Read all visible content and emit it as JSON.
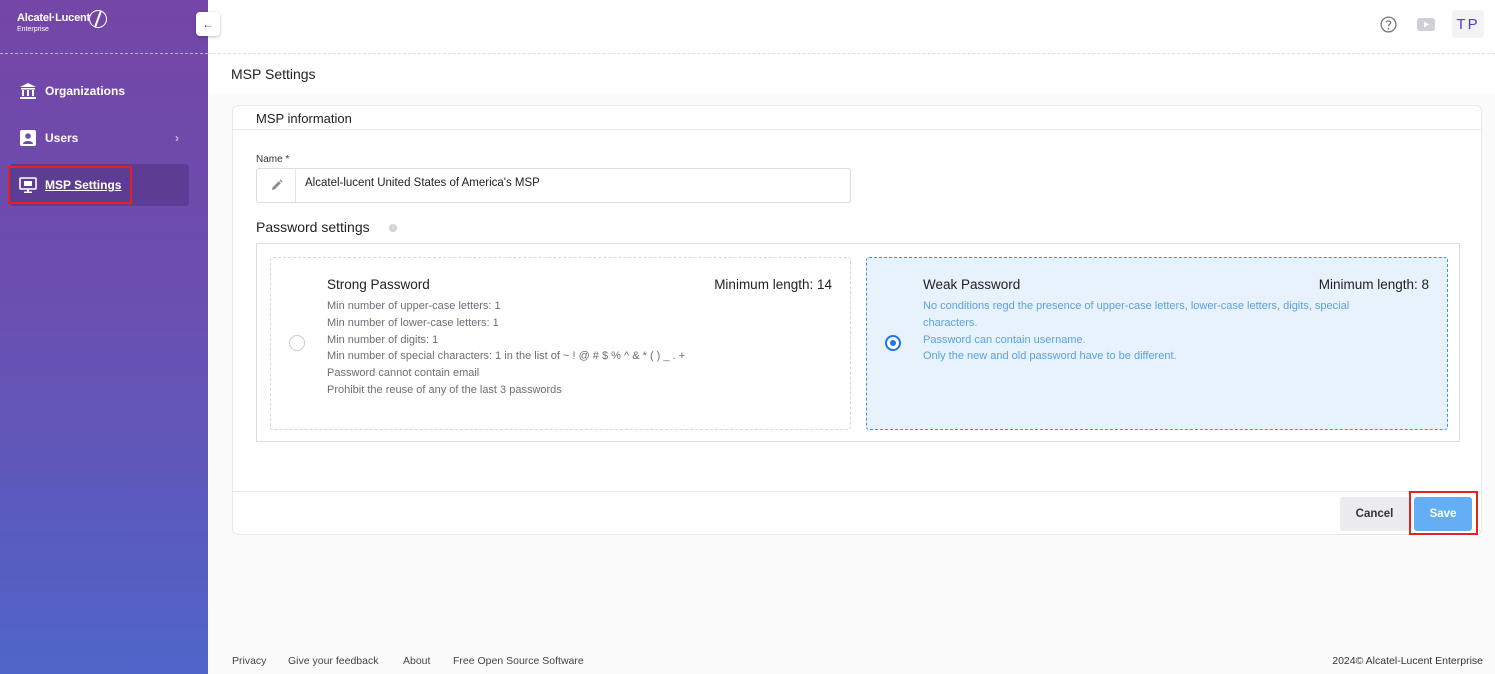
{
  "brand": {
    "name": "Alcatel·Lucent",
    "sub": "Enterprise"
  },
  "sidebar": {
    "collapse_glyph": "←",
    "items": [
      {
        "label": "Organizations",
        "icon": "bank-icon"
      },
      {
        "label": "Users",
        "icon": "user-card-icon",
        "chevron": "›"
      },
      {
        "label": "MSP Settings",
        "icon": "monitor-icon",
        "active": true
      }
    ]
  },
  "topbar": {
    "help_icon": "help-circle-icon",
    "video_icon": "youtube-icon",
    "avatar": "TP"
  },
  "page": {
    "title": "MSP Settings"
  },
  "card": {
    "title": "MSP information",
    "name_label": "Name *",
    "name_value": "Alcatel-lucent United States of America's MSP",
    "password_section": "Password settings",
    "info_glyph": "i",
    "strong": {
      "title": "Strong Password",
      "min": "Minimum length: 14",
      "lines": [
        "Min number of upper-case letters: 1",
        "Min number of lower-case letters: 1",
        "Min number of digits: 1",
        "Min number of special characters: 1 in the list of ~ ! @ # $ % ^ & * ( ) _ . +",
        "Password cannot contain email",
        "Prohibit the reuse of any of the last 3 passwords"
      ]
    },
    "weak": {
      "title": "Weak Password",
      "min": "Minimum length: 8",
      "lines": [
        "No conditions regd the presence of upper-case letters, lower-case letters, digits, special",
        "characters.",
        "Password can contain username.",
        "Only the new and old password have to be different."
      ],
      "selected": true
    },
    "cancel_label": "Cancel",
    "save_label": "Save"
  },
  "footer": {
    "links": [
      "Privacy",
      "Give your feedback",
      "About",
      "Free Open Source Software"
    ],
    "copyright": "2024© Alcatel-Lucent Enterprise"
  },
  "colors": {
    "accent": "#1e73e8",
    "save": "#63aef5",
    "highlight": "#e52222"
  }
}
